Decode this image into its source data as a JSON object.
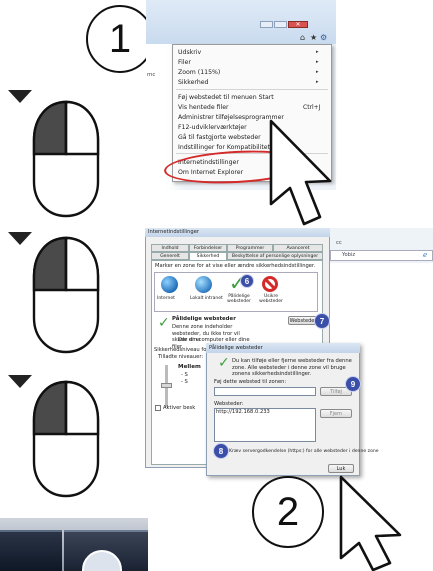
{
  "steps": {
    "one": "1",
    "two": "2"
  },
  "menu": {
    "items": [
      "Udskriv",
      "Filer",
      "Zoom (115%)",
      "Sikkerhed",
      "Føj webstedet til menuen Start",
      "Vis hentede filer",
      "Administrer tilføjelsesprogrammer",
      "F12-udviklerværktøjer",
      "Gå til fastgjorte websteder",
      "Indstillinger for Kompatibilitetsvisning",
      "Internetindstillinger",
      "Om Internet Explorer"
    ],
    "shortcut": "Ctrl+J",
    "side_text": "mc"
  },
  "inet": {
    "title": "Internetindstillinger",
    "tabs_row1": [
      "Indhold",
      "Forbindelser",
      "Programmer",
      "Avanceret"
    ],
    "tabs_row2": [
      "Generelt",
      "Sikkerhed",
      "Beskyttelse af personlige oplysninger"
    ],
    "instruction": "Marker en zone for at vise eller ændre sikkerhedsindstillinger.",
    "zones": [
      "Internet",
      "Lokalt intranet",
      "Pålidelige websteder",
      "Usikre websteder"
    ],
    "zone_head": "Pålidelige websteder",
    "zone_desc": "Denne zone indeholder websteder, du ikke tror vil skade din computer eller dine filer.",
    "sites_button": "Websteder",
    "zone_label": "Der er w",
    "level_label": "Sikkerhedsniveau for denne zone",
    "allowed": "Tilladte niveauer:",
    "level_name": "Mellem",
    "level_line1": "- S",
    "level_line2": "- S",
    "activate": "Aktiver besk",
    "side_text": "cc",
    "side_text2": "Yobiz"
  },
  "trusted": {
    "title": "Pålidelige websteder",
    "info": "Du kan tilføje eller fjerne websteder fra denne zone. Alle websteder i denne zone vil bruge zonens sikkerhedsindstillinger.",
    "add_label": "Føj dette websted til zonen:",
    "add_value": "",
    "add_button": "Tilføj",
    "list_label": "Websteder:",
    "site": "http://192.168.0.233",
    "remove_button": "Fjern",
    "checkbox_label": "Kræv servergodkendelse (https:) for alle websteder i denne zone",
    "close_button": "Luk"
  },
  "badges": [
    "6",
    "7",
    "8",
    "9"
  ],
  "colors": {
    "accent": "#3c4fa8",
    "highlight": "#d42a2a",
    "mouse_button": "#4a4a4a"
  }
}
